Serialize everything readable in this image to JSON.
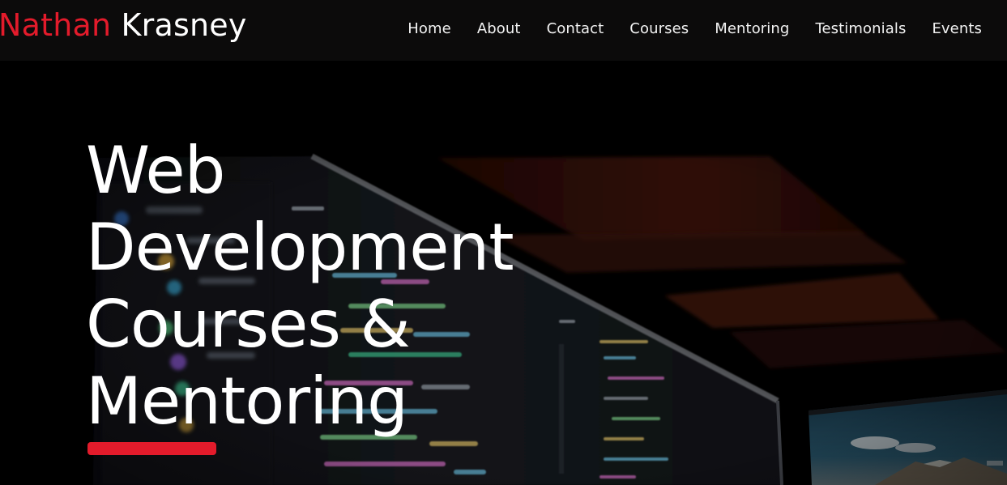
{
  "brand": {
    "first": "Nathan",
    "last": "Krasney"
  },
  "nav": [
    {
      "label": "Home"
    },
    {
      "label": "About"
    },
    {
      "label": "Contact"
    },
    {
      "label": "Courses"
    },
    {
      "label": "Mentoring"
    },
    {
      "label": "Testimonials"
    },
    {
      "label": "Events"
    }
  ],
  "hero": {
    "title_lines": [
      "Web",
      "Development",
      "Courses &",
      "Mentoring"
    ]
  },
  "colors": {
    "accent": "#e31b2b",
    "nav_bg": "#0c0b0b",
    "text": "#ffffff"
  }
}
